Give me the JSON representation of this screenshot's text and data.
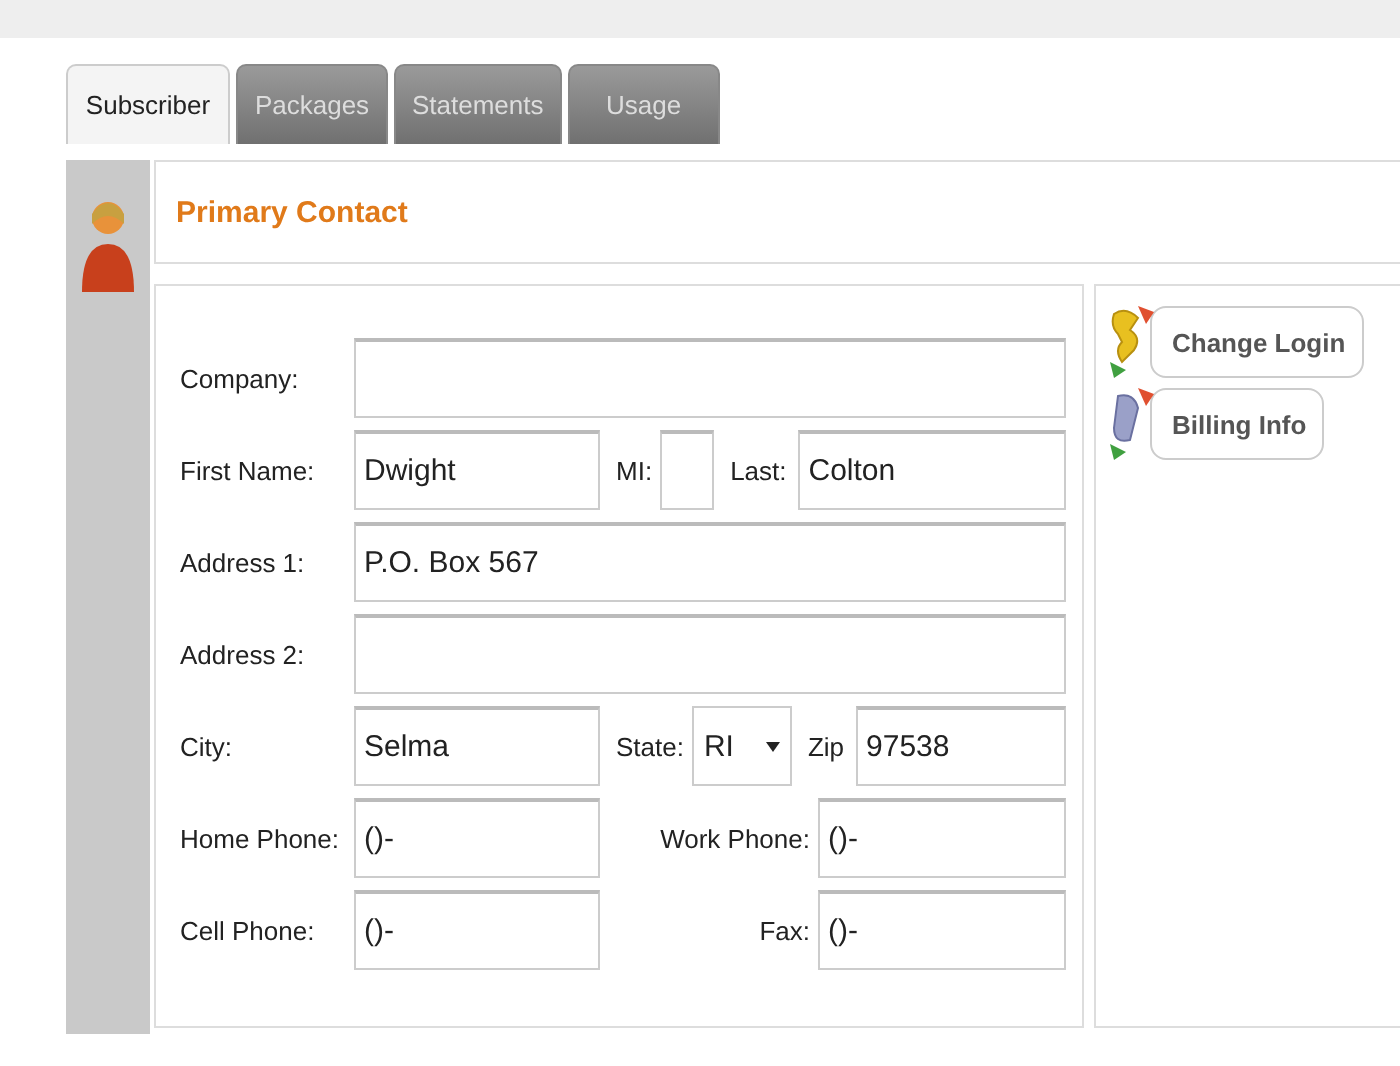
{
  "tabs": [
    {
      "label": "Subscriber",
      "selected": true
    },
    {
      "label": "Packages",
      "selected": false
    },
    {
      "label": "Statements",
      "selected": false
    },
    {
      "label": "Usage",
      "selected": false
    }
  ],
  "section": {
    "title": "Primary Contact"
  },
  "form": {
    "rows": [
      {
        "fields": [
          {
            "label": "Company:",
            "kind": "text"
          }
        ]
      },
      {
        "fields": [
          {
            "label": "First Name:",
            "kind": "text",
            "value": "Dwight"
          },
          {
            "label": "MI:",
            "kind": "text"
          },
          {
            "label": "Last:",
            "kind": "text",
            "value": "Colton"
          }
        ]
      },
      {
        "fields": [
          {
            "label": "Address 1:",
            "kind": "text",
            "value": "P.O. Box 567"
          }
        ]
      },
      {
        "fields": [
          {
            "label": "Address 2:",
            "kind": "text"
          }
        ]
      },
      {
        "fields": [
          {
            "label": "City:",
            "kind": "text",
            "value": "Selma"
          },
          {
            "label": "State:",
            "kind": "select",
            "value": "RI"
          },
          {
            "label": "Zip",
            "kind": "text",
            "value": "97538"
          }
        ]
      },
      {
        "fields": [
          {
            "label": "Home Phone:",
            "kind": "text",
            "value": "()-"
          },
          {
            "label": "Work Phone:",
            "kind": "text",
            "value": "()-"
          }
        ]
      },
      {
        "fields": [
          {
            "label": "Cell Phone:",
            "kind": "text",
            "value": "()-"
          },
          {
            "label": "Fax:",
            "kind": "text",
            "value": "()-"
          }
        ]
      }
    ]
  },
  "actions": [
    {
      "label": "Change Login",
      "kind": "key"
    },
    {
      "label": "Billing Info",
      "kind": "scroll"
    }
  ]
}
